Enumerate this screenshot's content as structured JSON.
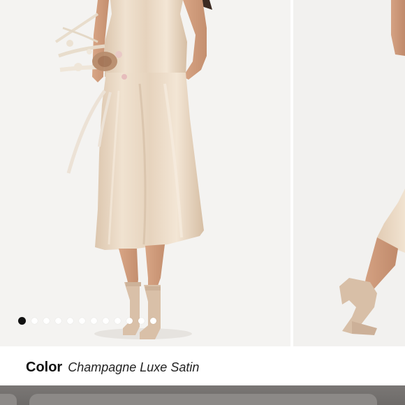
{
  "product": {
    "color_label": "Color",
    "color_value": "Champagne Luxe Satin"
  },
  "carousel": {
    "total_images": 12,
    "active_index": 0
  },
  "colors": {
    "dress": "#e9d8c4",
    "background": "#f3f2f0",
    "active_dot": "#111111",
    "inactive_dot": "#ffffff"
  }
}
